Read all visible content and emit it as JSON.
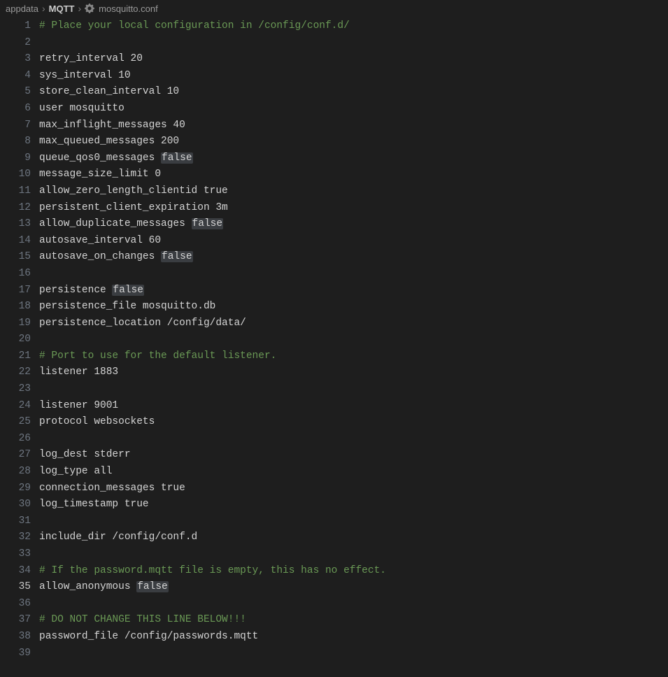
{
  "breadcrumb": {
    "items": [
      "appdata",
      "MQTT",
      "mosquitto.conf"
    ]
  },
  "activeLine": 35,
  "lines": [
    {
      "n": 1,
      "type": "comment",
      "text": "# Place your local configuration in /config/conf.d/"
    },
    {
      "n": 2,
      "type": "blank",
      "text": ""
    },
    {
      "n": 3,
      "type": "normal",
      "text": "retry_interval 20"
    },
    {
      "n": 4,
      "type": "normal",
      "text": "sys_interval 10"
    },
    {
      "n": 5,
      "type": "normal",
      "text": "store_clean_interval 10"
    },
    {
      "n": 6,
      "type": "normal",
      "text": "user mosquitto"
    },
    {
      "n": 7,
      "type": "normal",
      "text": "max_inflight_messages 40"
    },
    {
      "n": 8,
      "type": "normal",
      "text": "max_queued_messages 200"
    },
    {
      "n": 9,
      "type": "normal",
      "pre": "queue_qos0_messages ",
      "hl": "false",
      "post": ""
    },
    {
      "n": 10,
      "type": "normal",
      "text": "message_size_limit 0"
    },
    {
      "n": 11,
      "type": "normal",
      "text": "allow_zero_length_clientid true"
    },
    {
      "n": 12,
      "type": "normal",
      "text": "persistent_client_expiration 3m"
    },
    {
      "n": 13,
      "type": "normal",
      "pre": "allow_duplicate_messages ",
      "hl": "false",
      "post": ""
    },
    {
      "n": 14,
      "type": "normal",
      "text": "autosave_interval 60"
    },
    {
      "n": 15,
      "type": "normal",
      "pre": "autosave_on_changes ",
      "hl": "false",
      "post": ""
    },
    {
      "n": 16,
      "type": "blank",
      "text": ""
    },
    {
      "n": 17,
      "type": "normal",
      "pre": "persistence ",
      "hl": "false",
      "post": ""
    },
    {
      "n": 18,
      "type": "normal",
      "text": "persistence_file mosquitto.db"
    },
    {
      "n": 19,
      "type": "normal",
      "text": "persistence_location /config/data/"
    },
    {
      "n": 20,
      "type": "blank",
      "text": ""
    },
    {
      "n": 21,
      "type": "comment",
      "text": "# Port to use for the default listener."
    },
    {
      "n": 22,
      "type": "normal",
      "text": "listener 1883"
    },
    {
      "n": 23,
      "type": "blank",
      "text": ""
    },
    {
      "n": 24,
      "type": "normal",
      "text": "listener 9001"
    },
    {
      "n": 25,
      "type": "normal",
      "text": "protocol websockets"
    },
    {
      "n": 26,
      "type": "blank",
      "text": ""
    },
    {
      "n": 27,
      "type": "normal",
      "text": "log_dest stderr"
    },
    {
      "n": 28,
      "type": "normal",
      "text": "log_type all"
    },
    {
      "n": 29,
      "type": "normal",
      "text": "connection_messages true"
    },
    {
      "n": 30,
      "type": "normal",
      "text": "log_timestamp true"
    },
    {
      "n": 31,
      "type": "blank",
      "text": ""
    },
    {
      "n": 32,
      "type": "normal",
      "text": "include_dir /config/conf.d"
    },
    {
      "n": 33,
      "type": "blank",
      "text": ""
    },
    {
      "n": 34,
      "type": "comment",
      "text": "# If the password.mqtt file is empty, this has no effect."
    },
    {
      "n": 35,
      "type": "normal",
      "pre": "allow_anonymous ",
      "hl": "false",
      "post": ""
    },
    {
      "n": 36,
      "type": "blank",
      "text": ""
    },
    {
      "n": 37,
      "type": "comment",
      "text": "# DO NOT CHANGE THIS LINE BELOW!!!"
    },
    {
      "n": 38,
      "type": "normal",
      "text": "password_file /config/passwords.mqtt"
    },
    {
      "n": 39,
      "type": "blank",
      "text": ""
    }
  ]
}
